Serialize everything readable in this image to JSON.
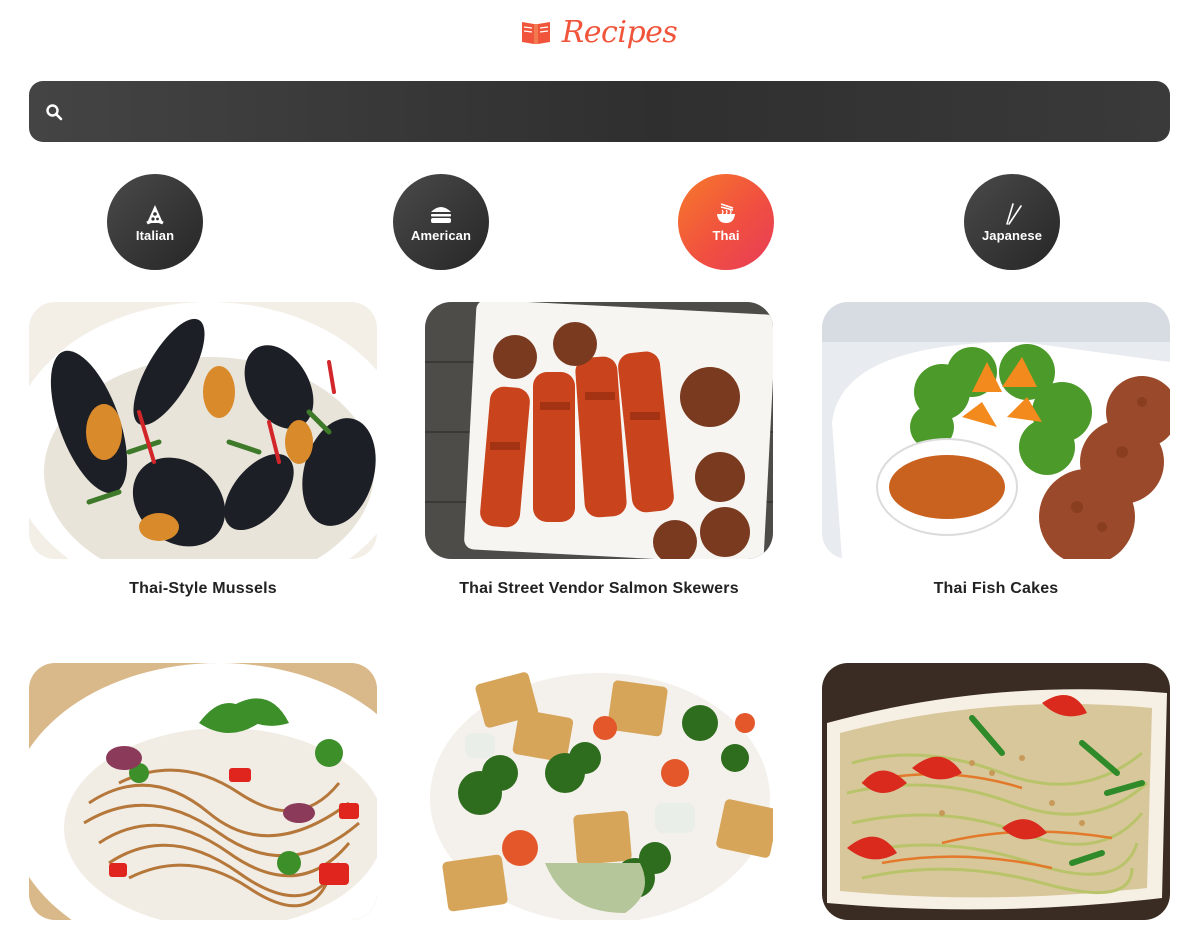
{
  "app": {
    "title": "Recipes",
    "logo_icon": "book-open-icon",
    "accent_color": "#f0543a"
  },
  "search": {
    "placeholder": "",
    "value": "",
    "icon": "search-icon"
  },
  "categories": [
    {
      "label": "Italian",
      "icon": "pizza-icon",
      "active": false
    },
    {
      "label": "American",
      "icon": "burger-icon",
      "active": false
    },
    {
      "label": "Thai",
      "icon": "noodle-bowl-icon",
      "active": true
    },
    {
      "label": "Japanese",
      "icon": "chopsticks-icon",
      "active": false
    }
  ],
  "recipes": [
    {
      "title": "Thai-Style Mussels",
      "image": "mussels-photo"
    },
    {
      "title": "Thai Street Vendor Salmon Skewers",
      "image": "salmon-skewers-photo"
    },
    {
      "title": "Thai Fish Cakes",
      "image": "fish-cakes-photo"
    },
    {
      "title": "",
      "image": "noodle-salad-photo"
    },
    {
      "title": "",
      "image": "tofu-vegetables-photo"
    },
    {
      "title": "",
      "image": "papaya-salad-photo"
    }
  ]
}
